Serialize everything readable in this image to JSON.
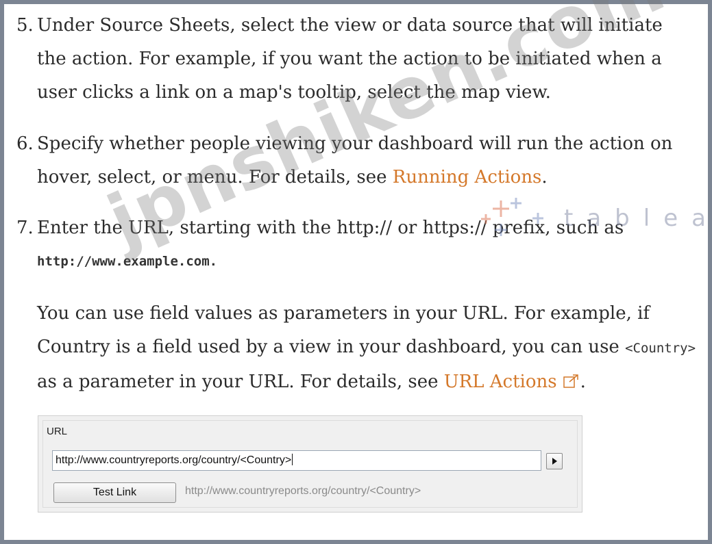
{
  "steps": [
    {
      "number": "5.",
      "text": "Under Source Sheets, select the view or data source that will initiate the action. For example, if you want the action to be initiated when a user clicks a link on a map's tooltip, select the map view."
    },
    {
      "number": "6.",
      "text_before": "Specify whether people viewing your dashboard will run the action on hover, select, or menu. For details, see ",
      "link": "Running Actions",
      "text_after": "."
    },
    {
      "number": "7.",
      "text": "Enter the URL, starting with the http:// or https:// prefix, such as",
      "code": "http://www.example.com.",
      "para_before": "You can use field values as parameters in your URL. For example, if Country is a field used by a view in your dashboard, you can use ",
      "para_code": "<Country>",
      "para_middle": " as a parameter in your URL. For details, see ",
      "para_link": "URL Actions",
      "para_after": "."
    }
  ],
  "dialog": {
    "label": "URL",
    "url_value": "http://www.countryreports.org/country/<Country>",
    "test_button": "Test Link",
    "preview": "http://www.countryreports.org/country/<Country>"
  },
  "watermarks": {
    "site": "jpnshiken.com",
    "brand": "tableau"
  },
  "colors": {
    "link": "#d4782a",
    "frame": "#7c8593"
  },
  "icons": {
    "external_link": "external-link-icon",
    "arrow": "play-arrow-icon"
  }
}
